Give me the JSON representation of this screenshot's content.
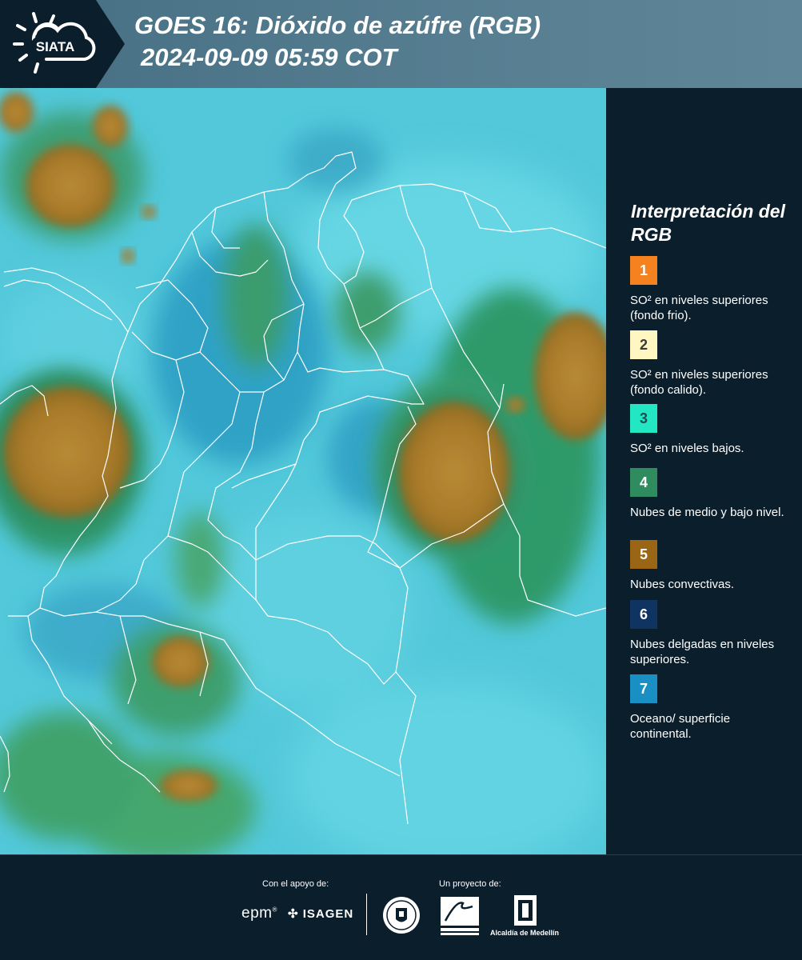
{
  "header": {
    "logo_text": "SIATA",
    "title_line1": "GOES 16: Dióxido de azúfre (RGB)",
    "title_line2": "2024-09-09 05:59 COT"
  },
  "legend": {
    "title": "Interpretación del RGB",
    "items": [
      {
        "number": "1",
        "label": "SO² en niveles superiores (fondo frio).",
        "color": "#f5821f",
        "text_color": "#ffffff"
      },
      {
        "number": "2",
        "label": "SO² en niveles superiores (fondo calido).",
        "color": "#fff6c2",
        "text_color": "#3a3a3a"
      },
      {
        "number": "3",
        "label": "SO² en niveles bajos.",
        "color": "#23e6c2",
        "text_color": "#1d4c54"
      },
      {
        "number": "4",
        "label": "Nubes de medio y bajo nivel.",
        "color": "#2f8c5f",
        "text_color": "#ffffff"
      },
      {
        "number": "5",
        "label": "Nubes convectivas.",
        "color": "#9a6514",
        "text_color": "#ffffff"
      },
      {
        "number": "6",
        "label": "Nubes delgadas en niveles superiores.",
        "color": "#103461",
        "text_color": "#ffffff"
      },
      {
        "number": "7",
        "label": "Oceano/ superficie continental.",
        "color": "#1a8fc4",
        "text_color": "#ffffff"
      }
    ]
  },
  "footer": {
    "support_caption": "Con el apoyo de:",
    "project_caption": "Un proyecto de:",
    "epm": "epm",
    "isagen": "ISAGEN",
    "alcaldia": "Alcaldía de Medellín"
  },
  "colors": {
    "background": "#0b1e2c",
    "map_base": "#4fc6d8",
    "convective": "#a87a2a",
    "mid_low_clouds": "#2f9a6a",
    "boundary": "#ffffff"
  }
}
